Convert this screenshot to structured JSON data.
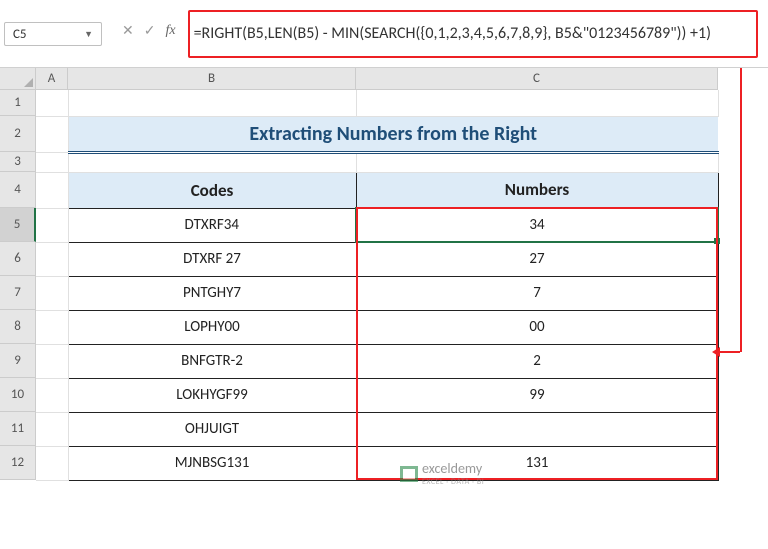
{
  "nameBox": {
    "value": "C5"
  },
  "formulaBar": {
    "text": "=RIGHT(B5,LEN(B5) - MIN(SEARCH({0,1,2,3,4,5,6,7,8,9}, B5&\"0123456789\")) +1)"
  },
  "columns": [
    "A",
    "B",
    "C"
  ],
  "rows": [
    "1",
    "2",
    "3",
    "4",
    "5",
    "6",
    "7",
    "8",
    "9",
    "10",
    "11",
    "12"
  ],
  "rowHeights": {
    "r1": 26,
    "r2": 36,
    "r3": 20,
    "r4": 36,
    "data": 34
  },
  "title": "Extracting Numbers from the Right",
  "headers": {
    "codes": "Codes",
    "numbers": "Numbers"
  },
  "tableData": [
    {
      "code": "DTXRF34",
      "number": "34"
    },
    {
      "code": "DTXRF 27",
      "number": "27"
    },
    {
      "code": "PNTGHY7",
      "number": "7"
    },
    {
      "code": "LOPHY00",
      "number": "00"
    },
    {
      "code": "BNFGTR-2",
      "number": "2"
    },
    {
      "code": "LOKHYGF99",
      "number": "99"
    },
    {
      "code": "OHJUIGT",
      "number": ""
    },
    {
      "code": "MJNBSG131",
      "number": "131"
    }
  ],
  "watermark": {
    "brand": "exceldemy",
    "tagline": "EXCEL · DATA · BI"
  },
  "selectedRow": 5,
  "chart_data": null
}
